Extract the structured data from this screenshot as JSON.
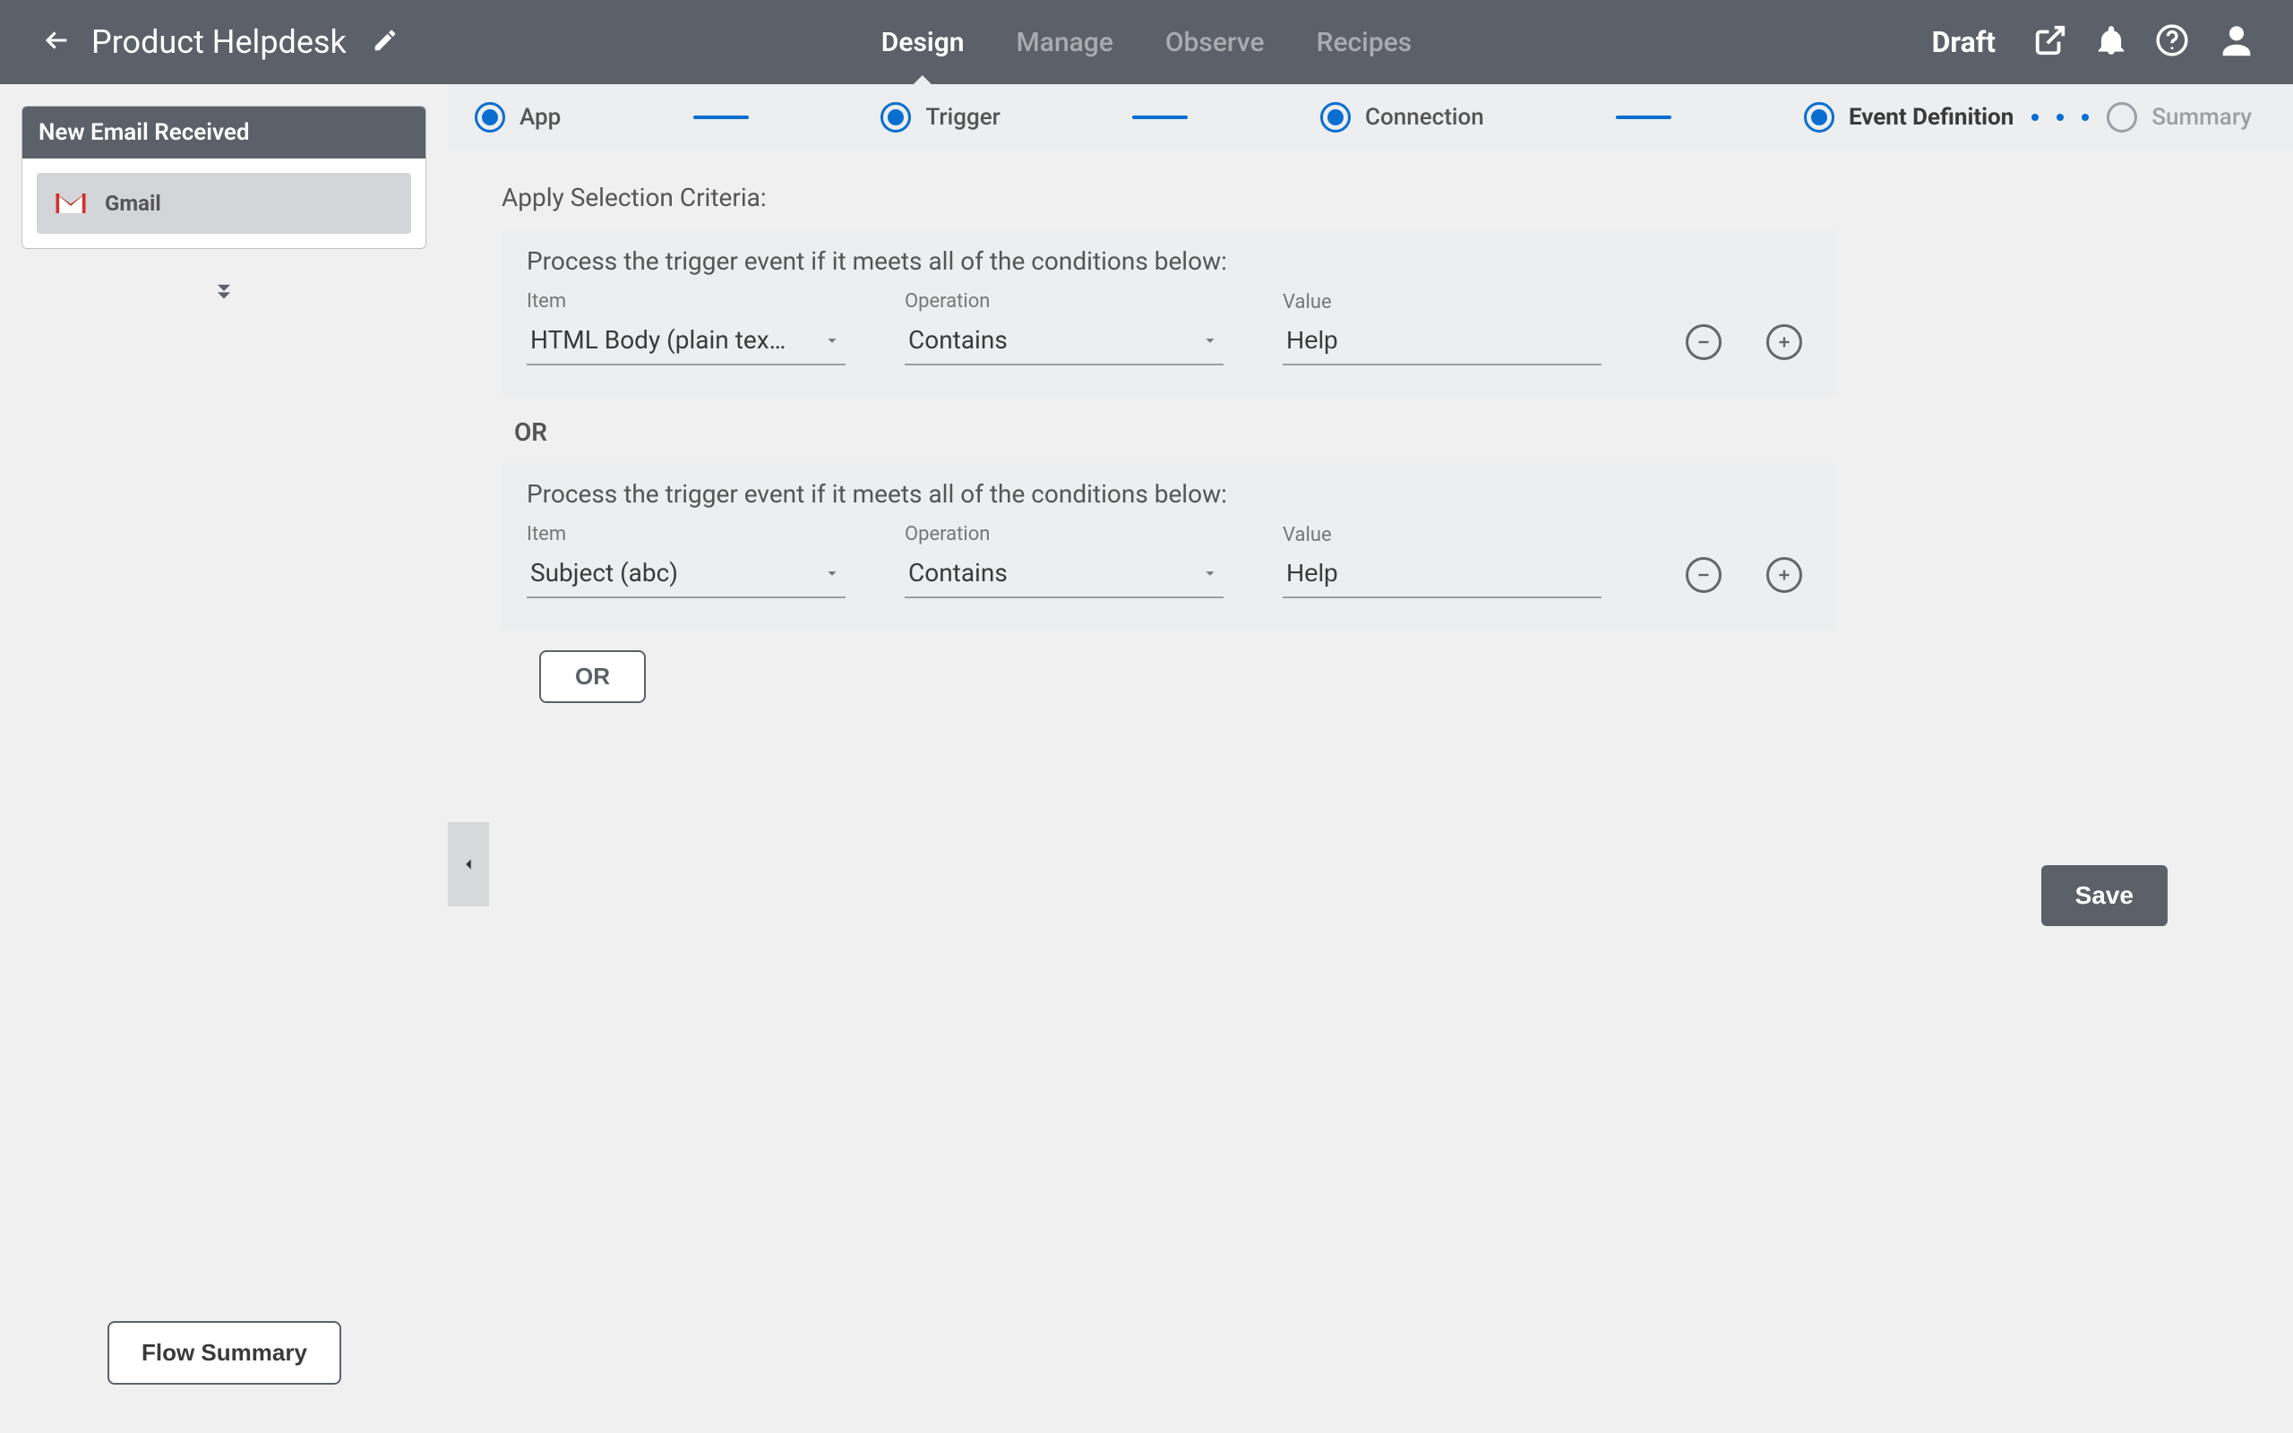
{
  "header": {
    "title": "Product Helpdesk",
    "tabs": [
      "Design",
      "Manage",
      "Observe",
      "Recipes"
    ],
    "active_tab": 0,
    "status": "Draft"
  },
  "wizard": {
    "steps": [
      "App",
      "Trigger",
      "Connection",
      "Event Definition",
      "Summary"
    ],
    "active": 3
  },
  "sidebar": {
    "flow_title": "New Email Received",
    "app_name": "Gmail",
    "summary_button": "Flow Summary"
  },
  "content": {
    "section_title": "Apply Selection Criteria:",
    "criteria_desc": "Process the trigger event if it meets all of the conditions below:",
    "labels": {
      "item": "Item",
      "operation": "Operation",
      "value": "Value"
    },
    "groups": [
      {
        "item": "HTML Body (plain tex…",
        "operation": "Contains",
        "value": "Help"
      },
      {
        "item": "Subject   (abc)",
        "operation": "Contains",
        "value": "Help"
      }
    ],
    "or_label": "OR",
    "add_or": "OR",
    "save": "Save"
  }
}
